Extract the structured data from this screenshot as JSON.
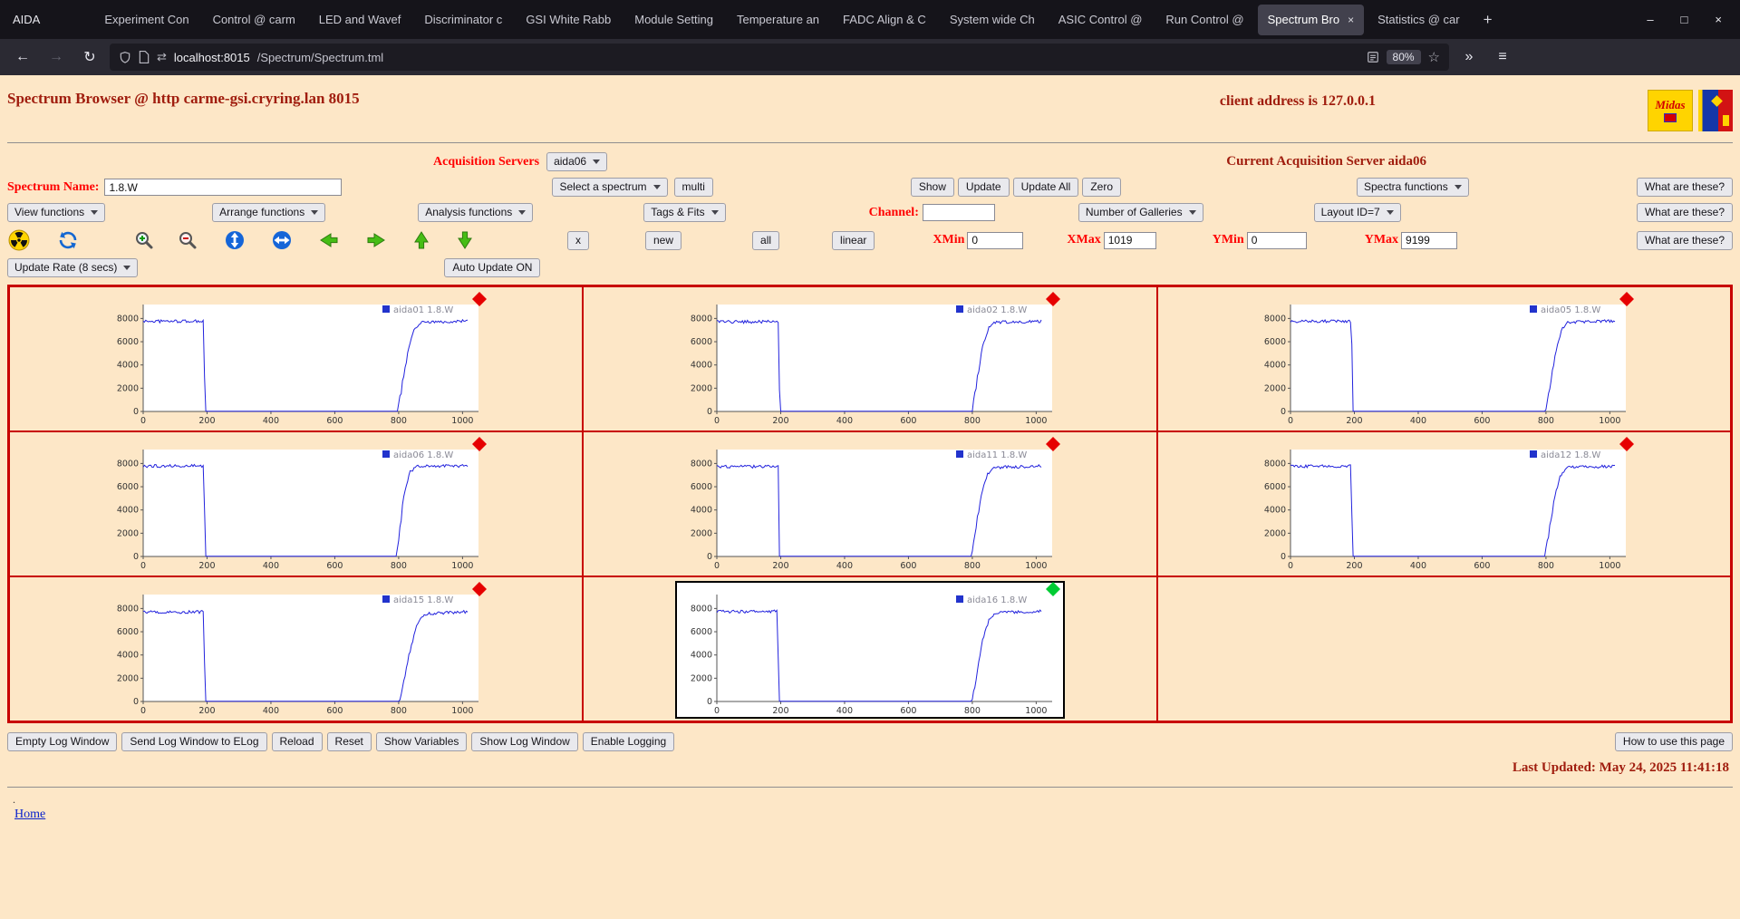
{
  "browser": {
    "app_label": "AIDA",
    "tab_close": "×",
    "tabs": [
      {
        "label": "Experiment Con",
        "active": false
      },
      {
        "label": "Control @ carm",
        "active": false
      },
      {
        "label": "LED and Wavef",
        "active": false
      },
      {
        "label": "Discriminator c",
        "active": false
      },
      {
        "label": "GSI White Rabb",
        "active": false
      },
      {
        "label": "Module Setting",
        "active": false
      },
      {
        "label": "Temperature an",
        "active": false
      },
      {
        "label": "FADC Align & C",
        "active": false
      },
      {
        "label": "System wide Ch",
        "active": false
      },
      {
        "label": "ASIC Control @",
        "active": false
      },
      {
        "label": "Run Control @",
        "active": false
      },
      {
        "label": "Spectrum Bro",
        "active": true
      },
      {
        "label": "Statistics @ car",
        "active": false
      }
    ],
    "new_tab": "+",
    "window_controls": {
      "minimize": "–",
      "maximize": "□",
      "close": "×"
    },
    "nav": {
      "back": "←",
      "forward": "→",
      "reload": "↻",
      "url_host": "localhost:8015",
      "url_path": "/Spectrum/Spectrum.tml",
      "swap": "⇄",
      "zoom_badge": "80%",
      "star": "☆",
      "overflow": "»",
      "menu": "≡"
    }
  },
  "page": {
    "title": "Spectrum Browser @ http carme-gsi.cryring.lan 8015",
    "client_address": "client address is 127.0.0.1",
    "midas_logo_text": "Midas",
    "acquisition": {
      "label": "Acquisition Servers",
      "selected": "aida06",
      "current": "Current Acquisition Server aida06"
    },
    "spectrum_row": {
      "name_label": "Spectrum Name:",
      "name_value": "1.8.W",
      "select_spectrum": "Select a spectrum",
      "multi": "multi",
      "show": "Show",
      "update": "Update",
      "update_all": "Update All",
      "zero": "Zero",
      "spectra_functions": "Spectra functions",
      "what": "What are these?"
    },
    "function_row": {
      "view": "View functions",
      "arrange": "Arrange functions",
      "analysis": "Analysis functions",
      "tags": "Tags & Fits",
      "channel_label": "Channel:",
      "channel_value": "",
      "galleries": "Number of Galleries",
      "layout": "Layout ID=7",
      "what": "What are these?"
    },
    "toolbar_row": {
      "x": "x",
      "new": "new",
      "all": "all",
      "linear": "linear",
      "xmin_label": "XMin",
      "xmin": "0",
      "xmax_label": "XMax",
      "xmax": "1019",
      "ymin_label": "YMin",
      "ymin": "0",
      "ymax_label": "YMax",
      "ymax": "9199",
      "what": "What are these?"
    },
    "update_row": {
      "rate": "Update Rate (8 secs)",
      "auto": "Auto Update ON"
    },
    "footer": {
      "buttons": [
        "Empty Log Window",
        "Send Log Window to ELog",
        "Reload",
        "Reset",
        "Show Variables",
        "Show Log Window",
        "Enable Logging"
      ],
      "help": "How to use this page",
      "last_updated": "Last Updated: May 24, 2025 11:41:18",
      "stray": ".",
      "home": "Home"
    }
  },
  "chart_data": {
    "type": "line",
    "layout": "3x3-gallery",
    "xlim": [
      0,
      1050
    ],
    "ylim": [
      0,
      9199
    ],
    "xticks": [
      0,
      200,
      400,
      600,
      800,
      1000
    ],
    "yticks": [
      0,
      2000,
      4000,
      6000,
      8000
    ],
    "line_color": "#2222dd",
    "legend_color": "#2233cc",
    "empty_cells": 1,
    "plots": [
      {
        "name": "aida01 1.8.W",
        "marker_color": "#e60000",
        "selected": false,
        "keypoints": [
          [
            0,
            7760
          ],
          [
            189,
            7760
          ],
          [
            194,
            20
          ],
          [
            797,
            20
          ],
          [
            809,
            1900
          ],
          [
            828,
            5100
          ],
          [
            848,
            7000
          ],
          [
            868,
            7650
          ],
          [
            1019,
            7790
          ]
        ]
      },
      {
        "name": "aida02 1.8.W",
        "marker_color": "#e60000",
        "selected": false,
        "keypoints": [
          [
            0,
            7700
          ],
          [
            193,
            7720
          ],
          [
            197,
            20
          ],
          [
            800,
            20
          ],
          [
            812,
            2100
          ],
          [
            830,
            5400
          ],
          [
            852,
            7200
          ],
          [
            872,
            7680
          ],
          [
            1019,
            7760
          ]
        ]
      },
      {
        "name": "aida05 1.8.W",
        "marker_color": "#e60000",
        "selected": false,
        "keypoints": [
          [
            0,
            7740
          ],
          [
            191,
            7750
          ],
          [
            195,
            20
          ],
          [
            799,
            20
          ],
          [
            810,
            1700
          ],
          [
            829,
            4900
          ],
          [
            850,
            7100
          ],
          [
            870,
            7700
          ],
          [
            1019,
            7780
          ]
        ]
      },
      {
        "name": "aida06 1.8.W",
        "marker_color": "#e60000",
        "selected": false,
        "keypoints": [
          [
            0,
            7780
          ],
          [
            190,
            7790
          ],
          [
            194,
            20
          ],
          [
            793,
            20
          ],
          [
            804,
            2300
          ],
          [
            818,
            5600
          ],
          [
            836,
            7300
          ],
          [
            858,
            7750
          ],
          [
            1019,
            7800
          ]
        ]
      },
      {
        "name": "aida11 1.8.W",
        "marker_color": "#e60000",
        "selected": false,
        "keypoints": [
          [
            0,
            7720
          ],
          [
            192,
            7730
          ],
          [
            196,
            20
          ],
          [
            798,
            20
          ],
          [
            809,
            2000
          ],
          [
            827,
            5200
          ],
          [
            847,
            7050
          ],
          [
            868,
            7660
          ],
          [
            1019,
            7770
          ]
        ]
      },
      {
        "name": "aida12 1.8.W",
        "marker_color": "#e60000",
        "selected": false,
        "keypoints": [
          [
            0,
            7750
          ],
          [
            190,
            7760
          ],
          [
            194,
            20
          ],
          [
            796,
            20
          ],
          [
            808,
            1800
          ],
          [
            826,
            5000
          ],
          [
            846,
            7000
          ],
          [
            866,
            7640
          ],
          [
            1019,
            7780
          ]
        ]
      },
      {
        "name": "aida15 1.8.W",
        "marker_color": "#e60000",
        "selected": false,
        "keypoints": [
          [
            0,
            7690
          ],
          [
            189,
            7700
          ],
          [
            194,
            20
          ],
          [
            803,
            20
          ],
          [
            816,
            1600
          ],
          [
            836,
            4400
          ],
          [
            860,
            6800
          ],
          [
            884,
            7550
          ],
          [
            1019,
            7720
          ]
        ]
      },
      {
        "name": "aida16 1.8.W",
        "marker_color": "#00cc33",
        "selected": true,
        "keypoints": [
          [
            0,
            7730
          ],
          [
            190,
            7740
          ],
          [
            194,
            20
          ],
          [
            799,
            20
          ],
          [
            811,
            1900
          ],
          [
            830,
            5100
          ],
          [
            852,
            7000
          ],
          [
            874,
            7620
          ],
          [
            1019,
            7760
          ]
        ]
      }
    ]
  }
}
